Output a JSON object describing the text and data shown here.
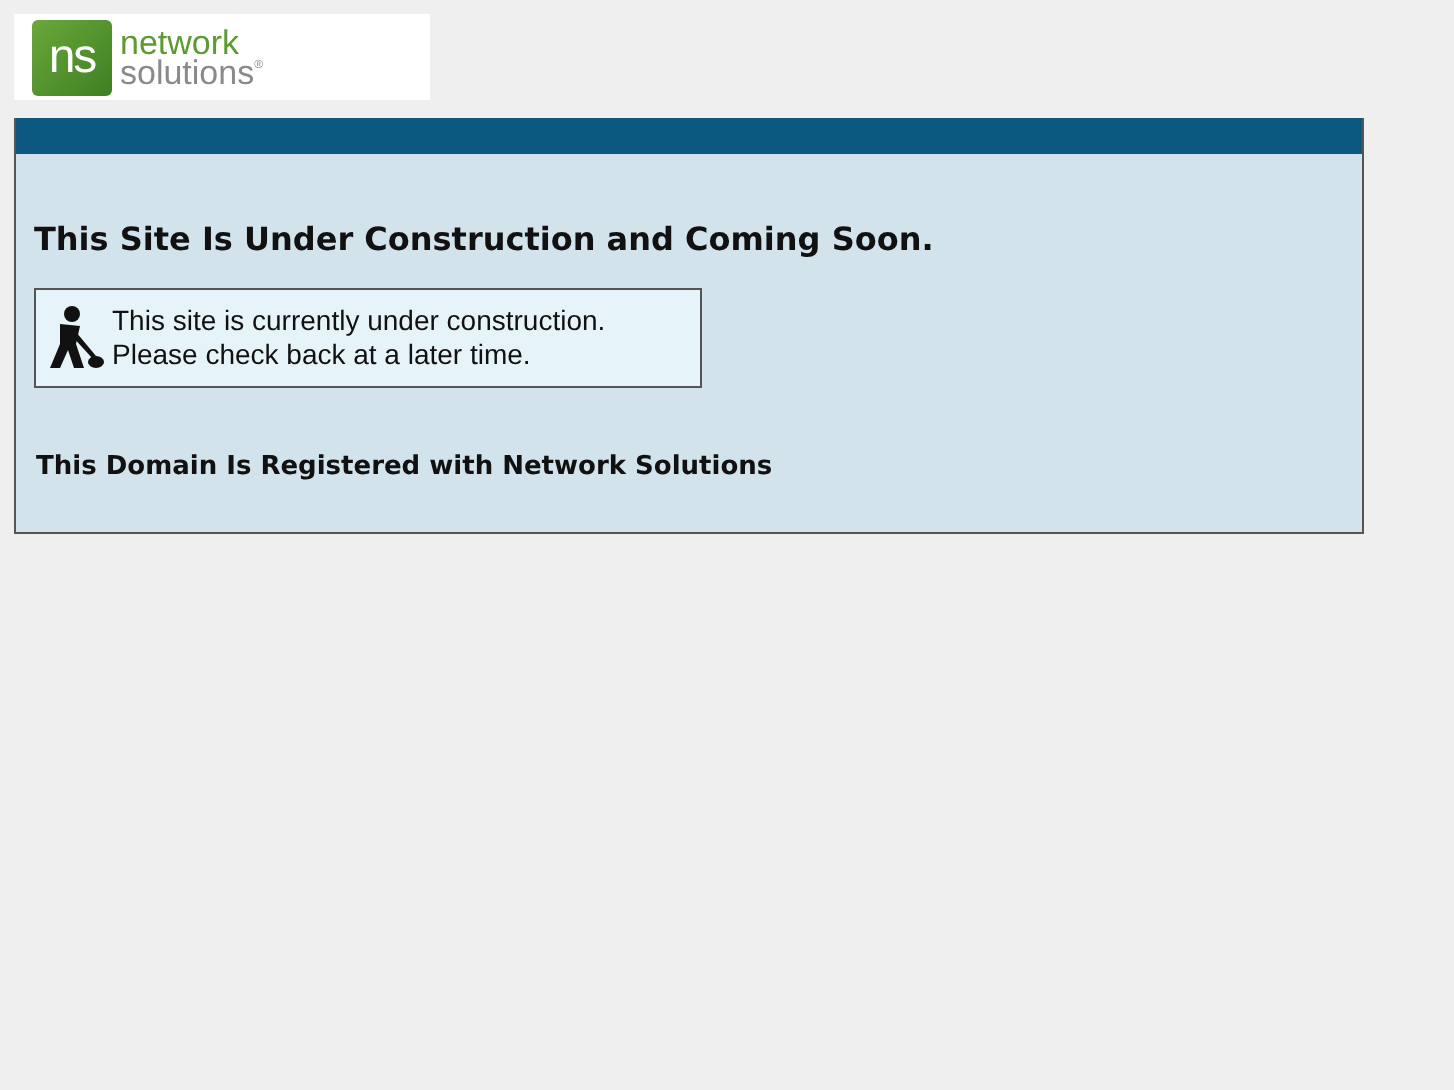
{
  "logo": {
    "mark": "ns",
    "line_1": "network",
    "line_2": "solutions",
    "trademark": "®"
  },
  "heading": "This Site Is Under Construction and Coming Soon.",
  "notice": {
    "line_1": "This site is currently under construction.",
    "line_2": "Please check back at a later time."
  },
  "footer": "This Domain Is Registered with Network Solutions"
}
